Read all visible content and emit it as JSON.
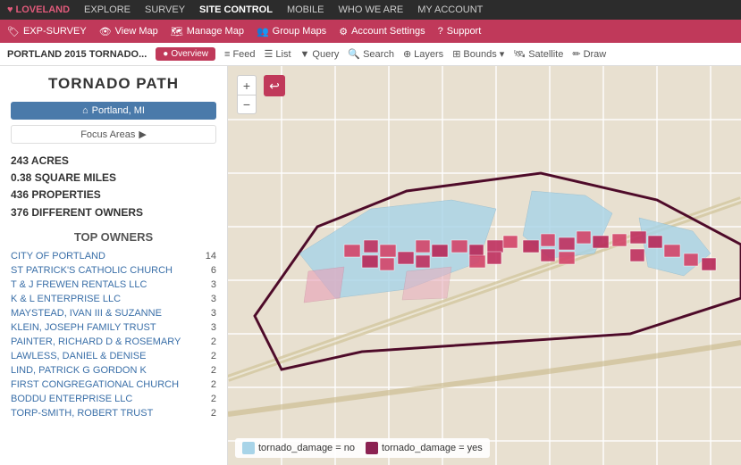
{
  "top_nav": {
    "brand": "LOVELAND",
    "items": [
      {
        "label": "EXPLORE",
        "active": false
      },
      {
        "label": "SURVEY",
        "active": false
      },
      {
        "label": "SITE CONTROL",
        "active": true
      },
      {
        "label": "MOBILE",
        "active": false
      },
      {
        "label": "WHO WE ARE",
        "active": false
      },
      {
        "label": "MY ACCOUNT",
        "active": false
      }
    ]
  },
  "second_nav": {
    "items": [
      {
        "label": "EXP-SURVEY",
        "icon": "tag"
      },
      {
        "label": "View Map",
        "icon": "eye"
      },
      {
        "label": "Manage Map",
        "icon": "map"
      },
      {
        "label": "Group Maps",
        "icon": "group"
      },
      {
        "label": "Account Settings",
        "icon": "gear"
      },
      {
        "label": "Support",
        "icon": "help"
      }
    ]
  },
  "third_nav": {
    "breadcrumb": "PORTLAND 2015 TORNADO...",
    "overview_label": "Overview",
    "tools": [
      {
        "label": "Feed",
        "icon": "feed"
      },
      {
        "label": "List",
        "icon": "list"
      },
      {
        "label": "Query",
        "icon": "filter"
      },
      {
        "label": "Search",
        "icon": "search"
      },
      {
        "label": "Layers",
        "icon": "layers"
      },
      {
        "label": "Bounds",
        "icon": "bounds"
      },
      {
        "label": "Satellite",
        "icon": "satellite"
      },
      {
        "label": "Draw",
        "icon": "pencil"
      }
    ]
  },
  "panel": {
    "title": "TORNADO PATH",
    "location": "Portland, MI",
    "focus_areas_label": "Focus Areas",
    "stats": {
      "acres": "243 ACRES",
      "square_miles": "0.38 SQUARE MILES",
      "properties": "436 PROPERTIES",
      "owners": "376 DIFFERENT OWNERS"
    },
    "top_owners_label": "TOP OWNERS",
    "owners": [
      {
        "name": "CITY OF PORTLAND",
        "count": 14
      },
      {
        "name": "ST PATRICK'S CATHOLIC CHURCH",
        "count": 6
      },
      {
        "name": "T & J FREWEN RENTALS LLC",
        "count": 3
      },
      {
        "name": "K & L ENTERPRISE LLC",
        "count": 3
      },
      {
        "name": "MAYSTEAD, IVAN III & SUZANNE",
        "count": 3
      },
      {
        "name": "KLEIN, JOSEPH FAMILY TRUST",
        "count": 3
      },
      {
        "name": "PAINTER, RICHARD D & ROSEMARY",
        "count": 2
      },
      {
        "name": "LAWLESS, DANIEL & DENISE",
        "count": 2
      },
      {
        "name": "LIND, PATRICK G GORDON K",
        "count": 2
      },
      {
        "name": "FIRST CONGREGATIONAL CHURCH",
        "count": 2
      },
      {
        "name": "BODDU ENTERPRISE LLC",
        "count": 2
      },
      {
        "name": "TORP-SMITH, ROBERT TRUST",
        "count": 2
      }
    ]
  },
  "legend": {
    "no_damage_label": "tornado_damage = no",
    "no_damage_color": "#a8d4e8",
    "damage_label": "tornado_damage = yes",
    "damage_color": "#8b2252"
  },
  "zoom": {
    "plus_label": "+",
    "minus_label": "−"
  }
}
